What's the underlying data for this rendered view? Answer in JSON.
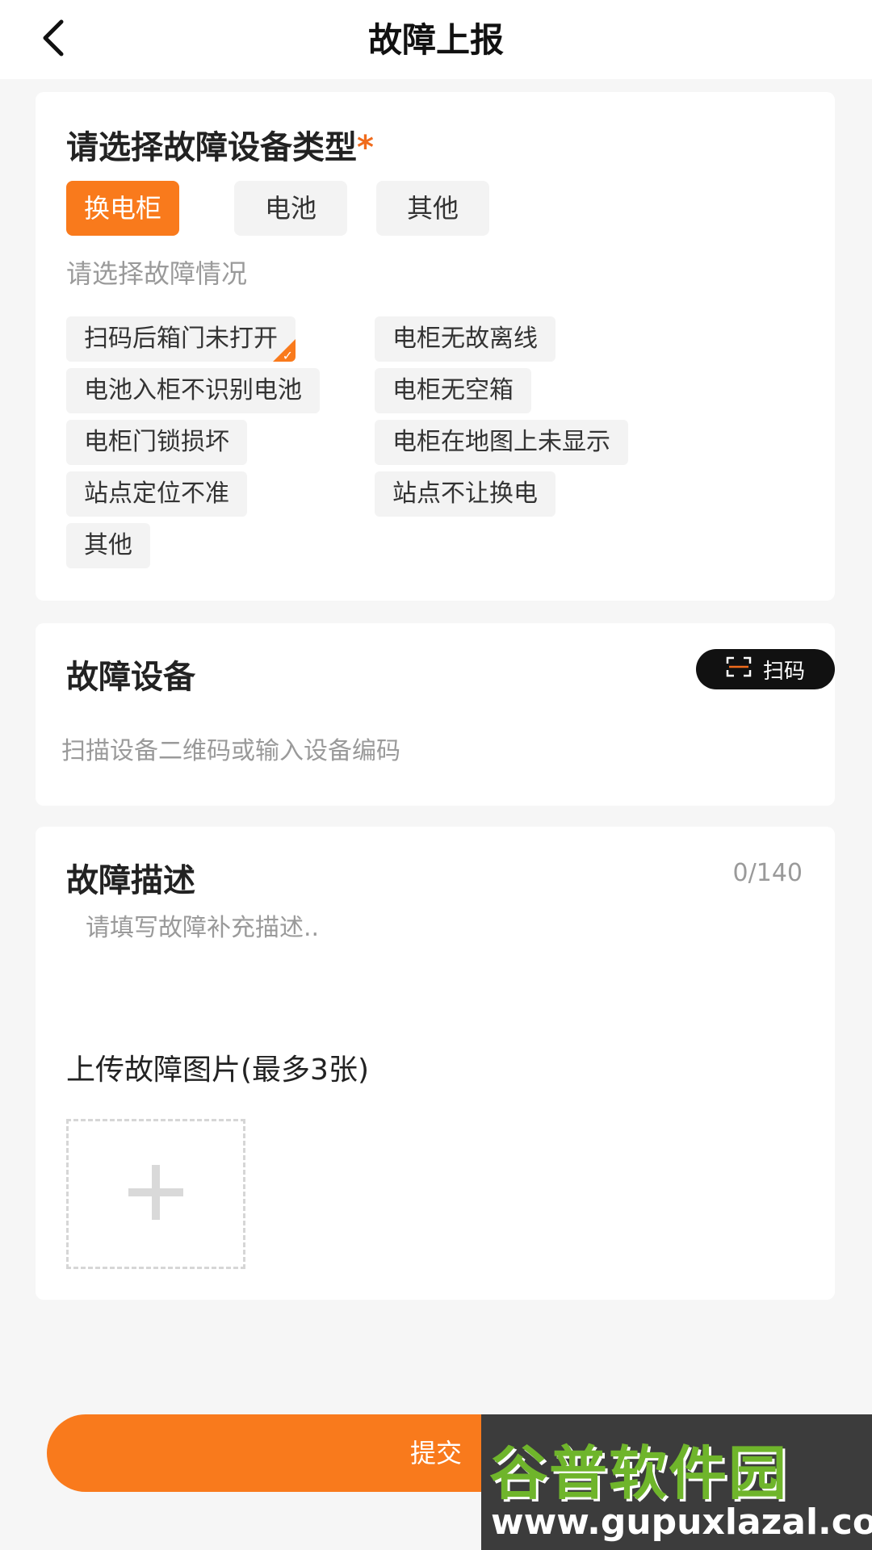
{
  "header": {
    "title": "故障上报",
    "back_icon": "chevron-left-icon"
  },
  "device_type": {
    "label": "请选择故障设备类型",
    "required_mark": "*",
    "options": [
      {
        "label": "换电柜",
        "selected": true
      },
      {
        "label": "电池",
        "selected": false
      },
      {
        "label": "其他",
        "selected": false
      }
    ]
  },
  "fault_situation": {
    "label": "请选择故障情况",
    "chips": [
      {
        "label": "扫码后箱门未打开",
        "selected": true
      },
      {
        "label": "电柜无故离线",
        "selected": false
      },
      {
        "label": "电池入柜不识别电池",
        "selected": false
      },
      {
        "label": "电柜无空箱",
        "selected": false
      },
      {
        "label": "电柜门锁损坏",
        "selected": false
      },
      {
        "label": "电柜在地图上未显示",
        "selected": false
      },
      {
        "label": "站点定位不准",
        "selected": false
      },
      {
        "label": "站点不让换电",
        "selected": false
      },
      {
        "label": "其他",
        "selected": false
      }
    ]
  },
  "fault_device": {
    "label": "故障设备",
    "scan_button": "扫码",
    "scan_icon": "scan-frame-icon",
    "placeholder": "扫描设备二维码或输入设备编码",
    "value": ""
  },
  "fault_description": {
    "label": "故障描述",
    "counter": "0/140",
    "placeholder": "请填写故障补充描述..",
    "value": ""
  },
  "upload": {
    "label": "上传故障图片(最多3张)",
    "add_icon": "plus-icon"
  },
  "submit_label": "提交",
  "watermark": {
    "name": "谷普软件园",
    "url": "www.gupuxlazal.com"
  },
  "colors": {
    "accent": "#f97a1c",
    "chip_bg": "#f3f3f3",
    "page_bg": "#f6f6f6"
  }
}
